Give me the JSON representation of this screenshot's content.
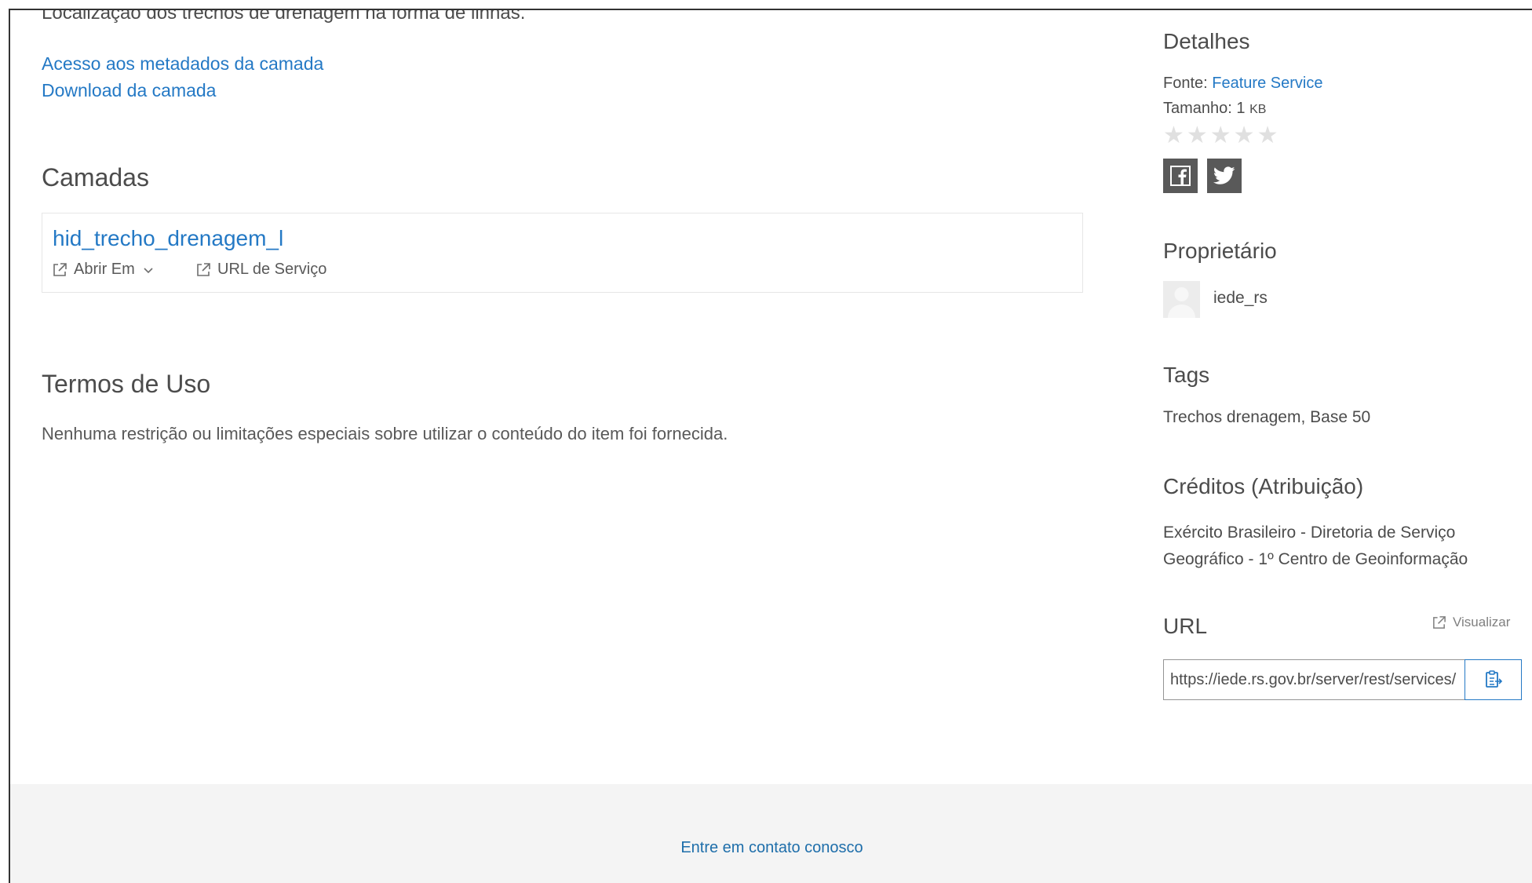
{
  "main": {
    "cut_description": "Localização dos trechos de drenagem na forma de linhas.",
    "links": {
      "metadata": "Acesso aos metadados da camada",
      "download": "Download da camada"
    },
    "layers": {
      "title": "Camadas",
      "items": [
        {
          "name": "hid_trecho_drenagem_l",
          "open_in_label": "Abrir Em",
          "service_url_label": "URL de Serviço"
        }
      ]
    },
    "terms": {
      "title": "Termos de Uso",
      "text": "Nenhuma restrição ou limitações especiais sobre utilizar o conteúdo do item foi fornecida."
    }
  },
  "sidebar": {
    "details": {
      "title": "Detalhes",
      "source_label": "Fonte:",
      "source_value": "Feature Service",
      "size_label": "Tamanho:",
      "size_value": "1",
      "size_unit": "KB",
      "rating_stars": "★★★★★",
      "rating_value": 0,
      "rating_max": 5
    },
    "share": {
      "facebook_icon": "facebook-icon",
      "twitter_icon": "twitter-icon"
    },
    "owner": {
      "title": "Proprietário",
      "name": "iede_rs"
    },
    "tags": {
      "title": "Tags",
      "value": "Trechos drenagem, Base 50"
    },
    "credits": {
      "title": "Créditos (Atribuição)",
      "line1": "Exército Brasileiro - Diretoria de Serviço",
      "line2": "Geográfico - 1º Centro de Geoinformação"
    },
    "url": {
      "title": "URL",
      "view_label": "Visualizar",
      "value": "https://iede.rs.gov.br/server/rest/services/"
    }
  },
  "footer": {
    "contact_label": "Entre em contato conosco"
  },
  "colors": {
    "link": "#2479c5",
    "text": "#4c4c4c",
    "footer_bg": "#f4f4f4",
    "social_bg": "#595959"
  }
}
